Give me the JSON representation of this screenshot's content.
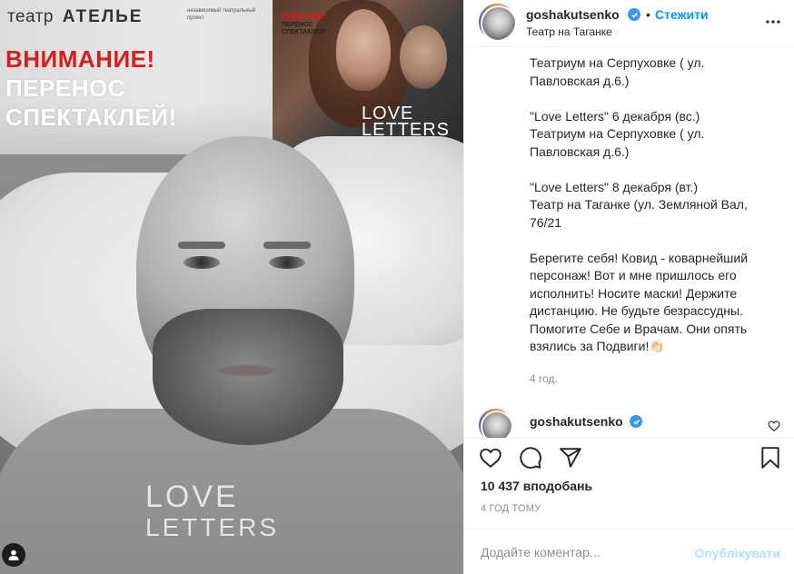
{
  "media": {
    "brand_prefix": "театр",
    "brand_name": "АТЕЛЬЕ",
    "brand_tagline": "независимый театральный проект",
    "alert": "ВНИМАНИЕ!",
    "move_line1": "ПЕРЕНОС",
    "move_line2": "СПЕКТАКЛЕЙ!",
    "mini_alert": "ВНИМАНИЕ!",
    "mini_sub1": "ПЕРЕНОС",
    "mini_sub2": "СПЕКТАКЛЕЙ!",
    "mini_logo": "LOVE LETTERS",
    "shirt_line1": "LOVE",
    "shirt_line2": "LETTERS"
  },
  "header": {
    "username": "goshakutsenko",
    "separator": "•",
    "follow_label": "Стежити",
    "location": "Театр на Таганке"
  },
  "caption": {
    "text": "Театриум на Серпуховке ( ул.\nПавловская д.6.)\n\n\"Love Letters\" 6 декабря (вс.)\nТеатриум на Серпуховке ( ул.\nПавловская д.6.)\n\n\"Love Letters\" 8 декабря (вт.)\nТеатр на Таганке (ул. Земляной Вал,\n76/21\n\nБерегите себя! Ковид - коварнейший\nперсонаж! Вот и мне пришлось его\nисполнить! Носите маски! Держите\nдистанцию. Не будьте безрассудны.\nПомогите Себе и Врачам. Они опять\nвзялись за Подвиги!👏🏻",
    "time": "4 год."
  },
  "comment2": {
    "username": "goshakutsenko"
  },
  "stats": {
    "likes": "10 437 вподобань",
    "date": "4 ГОД ТОМУ"
  },
  "add_comment": {
    "placeholder": "Додайте коментар...",
    "publish_label": "Опублікувати"
  },
  "colors": {
    "accent": "#0095f6",
    "verified": "#3897f0",
    "alert_red": "#d21f1f",
    "publish_disabled": "#b2dffc"
  }
}
